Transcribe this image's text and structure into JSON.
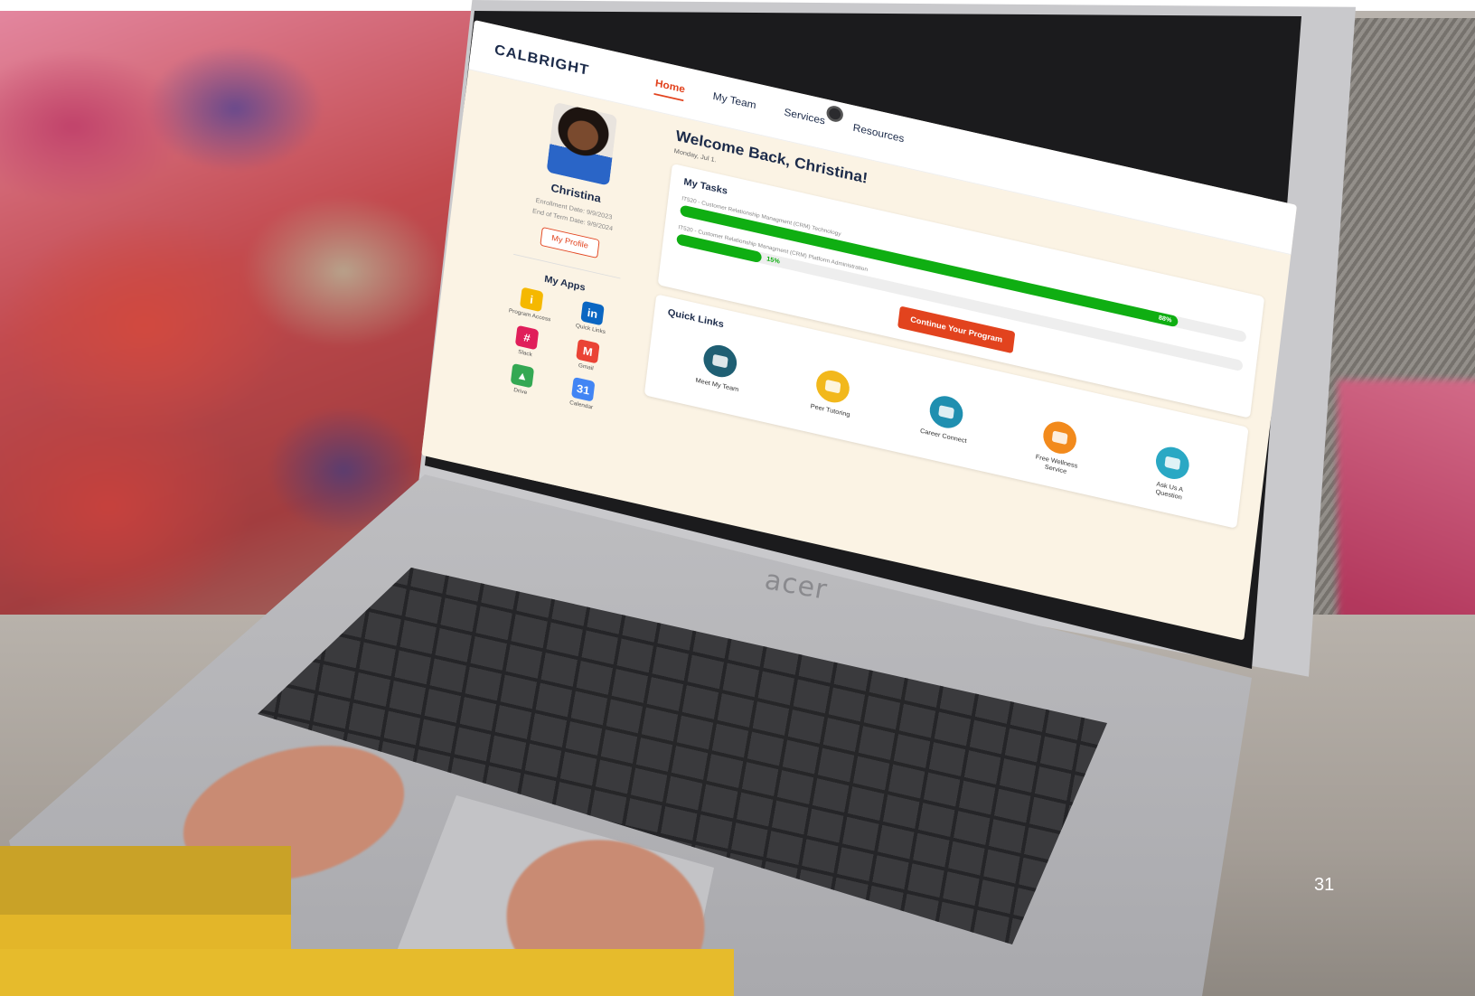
{
  "site": {
    "logo": "CALBRIGHT",
    "nav": [
      {
        "label": "Home",
        "active": true
      },
      {
        "label": "My Team",
        "active": false
      },
      {
        "label": "Services",
        "active": false
      },
      {
        "label": "Resources",
        "active": false
      }
    ]
  },
  "sidebar": {
    "name": "Christina",
    "enrollment": "Enrollment Date: 9/9/2023",
    "end_of_term": "End of Term Date: 9/9/2024",
    "profile_button": "My Profile",
    "apps_title": "My Apps",
    "apps": [
      {
        "label": "Program Access",
        "icon": "program-access-icon",
        "color": "#f5b800",
        "glyph": "i"
      },
      {
        "label": "Quick Links",
        "icon": "linkedin-icon",
        "color": "#0a66c2",
        "glyph": "in"
      },
      {
        "label": "Slack",
        "icon": "slack-icon",
        "color": "#e01e5a",
        "glyph": "#"
      },
      {
        "label": "Gmail",
        "icon": "gmail-icon",
        "color": "#ea4335",
        "glyph": "M"
      },
      {
        "label": "Drive",
        "icon": "drive-icon",
        "color": "#34a853",
        "glyph": "▲"
      },
      {
        "label": "Calendar",
        "icon": "calendar-icon",
        "color": "#4285f4",
        "glyph": "31"
      }
    ]
  },
  "main": {
    "welcome": "Welcome Back, Christina!",
    "date": "Monday, Jul 1.",
    "tasks_title": "My Tasks",
    "tasks": [
      {
        "label": "IT520 - Customer Relationship Managment (CRM) Technology",
        "progress": 0.88,
        "pct_label": "88%"
      },
      {
        "label": "IT520 - Customer Relationship Managment (CRM) Platform Administration",
        "progress": 0.15,
        "pct_label": "15%"
      }
    ],
    "cta": "Continue Your Program",
    "quick_links_title": "Quick Links",
    "quick_links": [
      {
        "label": "Meet My Team",
        "icon": "team-icon",
        "color": "#1f5f73"
      },
      {
        "label": "Peer Tutoring",
        "icon": "laptop-icon",
        "color": "#f2b81c"
      },
      {
        "label": "Career Connect",
        "icon": "briefcase-icon",
        "color": "#1f8fb0"
      },
      {
        "label": "Free Wellness Service",
        "icon": "clipboard-icon",
        "color": "#f28a1c"
      },
      {
        "label": "Ask Us A Question",
        "icon": "owl-icon",
        "color": "#2aa8c4"
      }
    ]
  },
  "laptop": {
    "brand": "acer"
  },
  "slide": {
    "page_number": "31"
  }
}
